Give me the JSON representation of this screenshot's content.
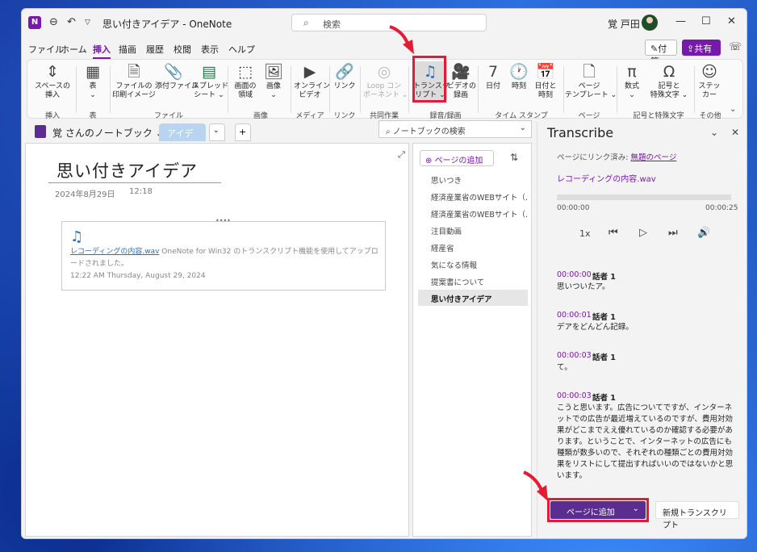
{
  "window": {
    "title": "思い付きアイデア  -  OneNote",
    "app_logo": "N",
    "search_placeholder": "検索",
    "user": "覚 戸田",
    "undo_icon": "↶",
    "back_icon": "⊖",
    "qat_icon": "▽"
  },
  "menu": {
    "items": [
      "ファイル",
      "ホーム",
      "挿入",
      "描画",
      "履歴",
      "校閲",
      "表示",
      "ヘルプ"
    ],
    "active": "挿入",
    "sticky": "付箋",
    "share": "共有"
  },
  "ribbon": {
    "buttons": [
      {
        "label": "スペースの\n挿入",
        "icon": "⇕"
      },
      {
        "label": "表\n⌄",
        "icon": "▦"
      },
      {
        "label": "ファイルの\n印刷イメージ",
        "icon": "🗎"
      },
      {
        "label": "添付ファイル",
        "icon": "📎"
      },
      {
        "label": "スプレッド\nシート ⌄",
        "icon": "▤"
      },
      {
        "label": "画面の\n領域",
        "icon": "⬚"
      },
      {
        "label": "画像\n⌄",
        "icon": "🖼"
      },
      {
        "label": "オンライン\nビデオ",
        "icon": "▶"
      },
      {
        "label": "リンク",
        "icon": "🔗"
      },
      {
        "label": "Loop コン\nポーネント ⌄",
        "icon": "◎"
      },
      {
        "label": "トランスク\nリプト ⌄",
        "icon": "♫"
      },
      {
        "label": "ビデオの\n録画",
        "icon": "🎥"
      },
      {
        "label": "日付",
        "icon": "7"
      },
      {
        "label": "時刻",
        "icon": "🕐"
      },
      {
        "label": "日付と\n時刻",
        "icon": "📅"
      },
      {
        "label": "ページ\nテンプレート ⌄",
        "icon": "🗋"
      },
      {
        "label": "数式\n⌄",
        "icon": "π"
      },
      {
        "label": "記号と\n特殊文字 ⌄",
        "icon": "Ω"
      },
      {
        "label": "ステッ\nカー",
        "icon": "☺"
      }
    ],
    "groups": [
      "挿入",
      "表",
      "ファイル",
      "画像",
      "メディア",
      "リンク",
      "共同作業",
      "録音/録画",
      "タイム スタンプ",
      "ページ",
      "記号と特殊文字",
      "その他"
    ]
  },
  "notebook": {
    "name": "覚 さんのノートブック ⌄",
    "section_tab": "アイデア",
    "tab_more": "⌄",
    "tab_add": "+",
    "search_placeholder": "ノートブックの検索"
  },
  "page": {
    "title": "思い付きアイデア",
    "date": "2024年8月29日",
    "time": "12:18",
    "note_link": "レコーディングの内容.wav",
    "note_text": " OneNote for Win32 のトランスクリプト機能を使用してアップロードされました。",
    "note_stamp": "12:22 AM Thursday, August 29, 2024"
  },
  "pages_list": {
    "add_page": "ページの追加",
    "items": [
      "思いつき",
      "経済産業省のWEBサイト（…",
      "経済産業省のWEBサイト（…",
      "注目動画",
      "経産省",
      "気になる情報",
      "提案書について",
      "思い付きアイデア"
    ],
    "selected": "思い付きアイデア"
  },
  "transcribe": {
    "title": "Transcribe",
    "linked_label": "ページにリンク済み: ",
    "linked_page": "無題のページ",
    "file": "レコーディングの内容.wav",
    "time_start": "00:00:00",
    "time_end": "00:00:25",
    "speed": "1x",
    "playback_progress": 0,
    "segments": [
      {
        "time": "00:00:00",
        "speaker": "話者 1",
        "text": "思いついたア。"
      },
      {
        "time": "00:00:01",
        "speaker": "話者 1",
        "text": "デアをどんどん記録。"
      },
      {
        "time": "00:00:03",
        "speaker": "話者 1",
        "text": "て。"
      },
      {
        "time": "00:00:03",
        "speaker": "話者 1",
        "text": "こうと思います。広告についてですが、インターネットでの広告が最近増えているのですが、費用対効果がどこまでええ優れているのか確認する必要があります。ということで、インターネットの広告にも種類が数多いので、それぞれの種類ごとの費用対効果をリストにして提出すればいいのではないかと思います。"
      }
    ],
    "add_to_page": "ページに追加",
    "new_transcript": "新規トランスクリプト"
  }
}
